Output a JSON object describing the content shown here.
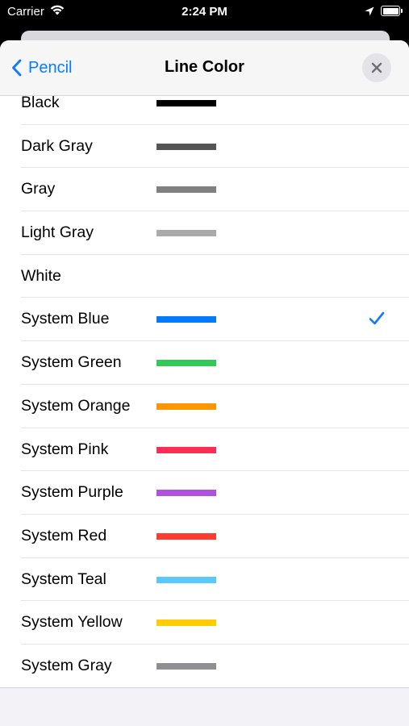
{
  "status": {
    "carrier": "Carrier",
    "time": "2:24 PM"
  },
  "nav": {
    "back_label": "Pencil",
    "title": "Line Color"
  },
  "selected": "System Blue",
  "colors": [
    {
      "name": "Black",
      "color": "#000000"
    },
    {
      "name": "Dark Gray",
      "color": "#555555"
    },
    {
      "name": "Gray",
      "color": "#808080"
    },
    {
      "name": "Light Gray",
      "color": "#aaaaaa"
    },
    {
      "name": "White",
      "color": "#ffffff"
    },
    {
      "name": "System Blue",
      "color": "#007aff"
    },
    {
      "name": "System Green",
      "color": "#34c759"
    },
    {
      "name": "System Orange",
      "color": "#ff9500"
    },
    {
      "name": "System Pink",
      "color": "#ff2d55"
    },
    {
      "name": "System Purple",
      "color": "#af52de"
    },
    {
      "name": "System Red",
      "color": "#ff3b30"
    },
    {
      "name": "System Teal",
      "color": "#5ac8fa"
    },
    {
      "name": "System Yellow",
      "color": "#ffcc00"
    },
    {
      "name": "System Gray",
      "color": "#8e8e93"
    }
  ],
  "theme": {
    "accent": "#0a7aff"
  }
}
